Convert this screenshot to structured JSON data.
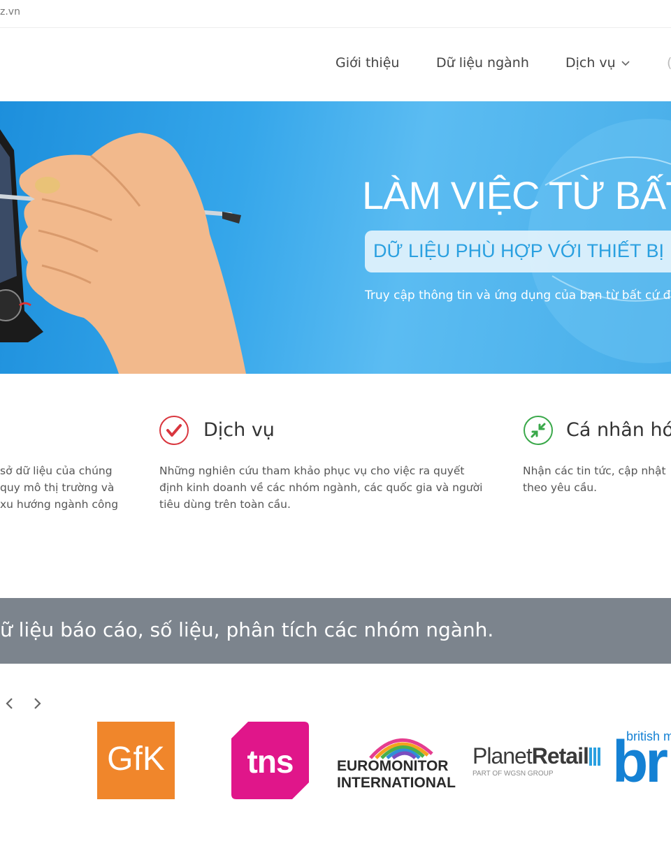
{
  "topbar": {
    "domain": "z.vn"
  },
  "nav": {
    "items": [
      {
        "label": "Giới thiệu"
      },
      {
        "label": "Dữ liệu ngành"
      },
      {
        "label": "Dịch vụ"
      },
      {
        "label": "("
      }
    ]
  },
  "hero": {
    "headline": "LÀM VIỆC TỪ BẤT",
    "pill": "DỮ LIỆU PHÙ HỢP VỚI THIẾT BỊ I",
    "subtext": "Truy cập thông tin và ứng dụng của bạn từ bất cứ đ"
  },
  "features": [
    {
      "title": "",
      "lines": [
        "sở dữ liệu của chúng",
        "quy mô thị trường và",
        "xu hướng ngành công"
      ]
    },
    {
      "title": "Dịch vụ",
      "icon": "check-circle-icon",
      "lines": [
        "Những nghiên cứu tham khảo phục vụ cho việc ra quyết",
        "định kinh doanh về các nhóm ngành, các quốc gia và người",
        "tiêu dùng trên toàn cầu."
      ]
    },
    {
      "title": "Cá nhân hóa",
      "icon": "compress-arrows-icon",
      "lines": [
        "Nhận các tin tức, cập nhật",
        "theo yêu cầu."
      ]
    }
  ],
  "banner": {
    "text": "ữ liệu báo cáo, số liệu, phân tích các nhóm ngành."
  },
  "partners": {
    "gfk": "GfK",
    "tns": "tns",
    "euromonitor_1": "EUROMONITOR",
    "euromonitor_2": "INTERNATIONAL",
    "planet_a": "Planet",
    "planet_b": "Retail",
    "planet_sub": "PART OF WGSN GROUP",
    "bm_small": "british m",
    "bm_big": "br"
  },
  "colors": {
    "nav_text": "#444444",
    "hero_blue": "#35a6ea",
    "check_red": "#d9363e",
    "personal_green": "#3aa84a",
    "banner_gray": "#7c848d",
    "gfk_orange": "#f0862b",
    "tns_pink": "#e0168a",
    "bm_blue": "#1481d4"
  }
}
